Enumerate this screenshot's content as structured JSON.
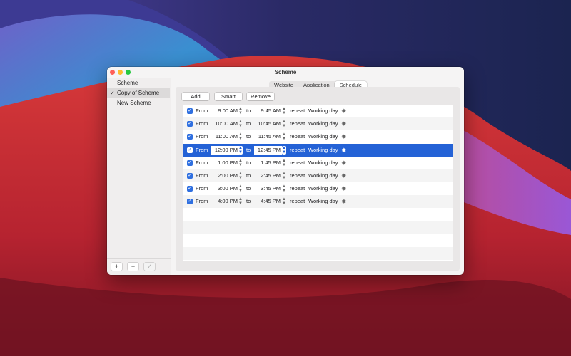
{
  "window": {
    "title": "Scheme"
  },
  "sidebar": {
    "items": [
      {
        "label": "Scheme",
        "checked": false,
        "selected": false
      },
      {
        "label": "Copy of Scheme",
        "checked": true,
        "selected": true
      },
      {
        "label": "New Scheme",
        "checked": false,
        "selected": false
      }
    ],
    "checkmark": "✓",
    "footer": {
      "add": "+",
      "remove": "−",
      "apply": "✓"
    }
  },
  "tabs": [
    {
      "label": "Website",
      "active": false
    },
    {
      "label": "Application",
      "active": false
    },
    {
      "label": "Schedule",
      "active": true
    }
  ],
  "toolbar": {
    "add": "Add",
    "smart": "Smart",
    "remove": "Remove"
  },
  "schedule": {
    "from_label": "From",
    "to_label": "to",
    "repeat_label": "repeat",
    "gear_icon": "gear-icon",
    "selected_row": 3,
    "rows": [
      {
        "enabled": true,
        "from": "9:00 AM",
        "to": "9:45 AM",
        "repeat": "Working day"
      },
      {
        "enabled": true,
        "from": "10:00 AM",
        "to": "10:45 AM",
        "repeat": "Working day"
      },
      {
        "enabled": true,
        "from": "11:00 AM",
        "to": "11:45 AM",
        "repeat": "Working day"
      },
      {
        "enabled": true,
        "from": "12:00 PM",
        "to": "12:45 PM",
        "repeat": "Working day"
      },
      {
        "enabled": true,
        "from": "1:00 PM",
        "to": "1:45 PM",
        "repeat": "Working day"
      },
      {
        "enabled": true,
        "from": "2:00 PM",
        "to": "2:45 PM",
        "repeat": "Working day"
      },
      {
        "enabled": true,
        "from": "3:00 PM",
        "to": "3:45 PM",
        "repeat": "Working day"
      },
      {
        "enabled": true,
        "from": "4:00 PM",
        "to": "4:45 PM",
        "repeat": "Working day"
      }
    ]
  },
  "colors": {
    "accent": "#2462d6",
    "close": "#ff5f57",
    "minimize": "#febc2e",
    "maximize": "#28c840"
  }
}
